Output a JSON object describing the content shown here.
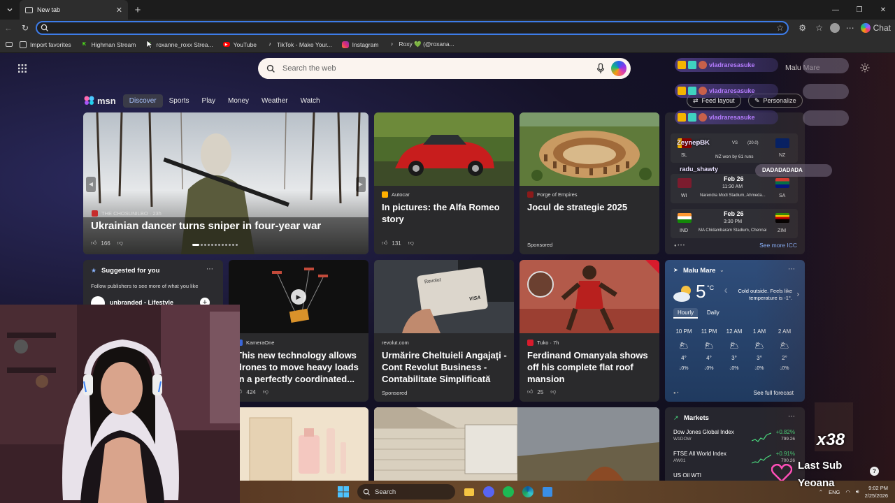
{
  "browser": {
    "tab_title": "New tab",
    "address_value": "",
    "chat_label": "Chat",
    "bookmarks": [
      {
        "label": "Import favorites"
      },
      {
        "label": "Highman Stream"
      },
      {
        "label": "roxanne_roxx Strea..."
      },
      {
        "label": "YouTube"
      },
      {
        "label": "TikTok - Make Your..."
      },
      {
        "label": "Instagram"
      },
      {
        "label": "Roxy 💚 (@roxana..."
      }
    ]
  },
  "newtab": {
    "search_placeholder": "Search the web",
    "user_name": "Malu Mare",
    "feed_layout_label": "Feed layout",
    "personalize_label": "Personalize"
  },
  "msn": {
    "logo": "msn",
    "nav": [
      {
        "label": "Discover",
        "active": true
      },
      {
        "label": "Sports"
      },
      {
        "label": "Play"
      },
      {
        "label": "Money"
      },
      {
        "label": "Weather"
      },
      {
        "label": "Watch"
      }
    ]
  },
  "cards": {
    "hero": {
      "source": "THE CHOSUNILBO · 23h",
      "title": "Ukrainian dancer turns sniper in four-year war",
      "likes": "166"
    },
    "alfa": {
      "source": "Autocar",
      "title": "In pictures: the Alfa Romeo story",
      "likes": "131"
    },
    "forge": {
      "source": "Forge of Empires",
      "title": "Jocul de strategie 2025",
      "sponsored": "Sponsored"
    },
    "suggested": {
      "header": "Suggested for you",
      "sub": "Follow publishers to see more of what you like",
      "publisher": "unbranded - Lifestyle"
    },
    "drone": {
      "source": "KameraOne",
      "title_lines": [
        "This new technology allows",
        "drones to move heavy loads",
        "in a perfectly coordinated..."
      ],
      "likes": "424"
    },
    "revolut": {
      "source": "revolut.com",
      "title": "Urmărire Cheltuieli Angajați - Cont Revolut Business - Contabilitate Simplificată",
      "sponsored": "Sponsored",
      "card_brand": "Revolut",
      "card_network": "VISA"
    },
    "omanyala": {
      "source": "Tuko · 7h",
      "title": "Ferdinand Omanyala shows off his complete flat roof mansion",
      "likes": "25"
    }
  },
  "cricket": {
    "match1": {
      "team1": "SL",
      "team1_score": "(20.0)",
      "vs": "VS",
      "team2": "NZ",
      "team2_score": "(20.0)",
      "result": "NZ won by 61 runs"
    },
    "match2": {
      "date": "Feb 26",
      "time": "11:30 AM",
      "team1": "WI",
      "team2": "SA",
      "venue": "Narendra Modi Stadium, Ahmeda..."
    },
    "match3": {
      "date": "Feb 26",
      "time": "3:30 PM",
      "team1": "IND",
      "team2": "ZIM",
      "venue": "MA Chidambaram Stadium, Chennai"
    },
    "see_more": "See more ICC"
  },
  "weather": {
    "location": "Malu Mare",
    "temp": "5",
    "unit": "°C",
    "desc": "Cold outside. Feels like temperature is -1°.",
    "tab_hourly": "Hourly",
    "tab_daily": "Daily",
    "hours": [
      {
        "time": "10 PM",
        "temp": "4°",
        "precip": "0%"
      },
      {
        "time": "11 PM",
        "temp": "4°",
        "precip": "0%"
      },
      {
        "time": "12 AM",
        "temp": "3°",
        "precip": "0%"
      },
      {
        "time": "1 AM",
        "temp": "3°",
        "precip": "0%"
      },
      {
        "time": "2 AM",
        "temp": "2°",
        "precip": "0%"
      }
    ],
    "full_forecast": "See full forecast"
  },
  "markets": {
    "title": "Markets",
    "rows": [
      {
        "name": "Dow Jones Global Index",
        "code": "W1DOW",
        "change": "+0.82%",
        "value": "799.26"
      },
      {
        "name": "FTSE All World Index",
        "code": "AW01",
        "change": "+0.91%",
        "value": "700.26"
      },
      {
        "name": "US Oil WTI",
        "code": "",
        "change": "",
        "value": ""
      }
    ]
  },
  "taskbar": {
    "search_label": "Search",
    "lang": "ENG",
    "time": "9:02 PM",
    "date": "2/25/2026"
  },
  "overlay": {
    "chat_user": "vladraresasuke",
    "names": [
      "ZeynepBK",
      "radu_shawty",
      "DADADADADA"
    ],
    "count": "x38",
    "last_sub_label": "Last Sub",
    "last_sub_name": "Yeoana"
  },
  "colors": {
    "accent": "#3d7ce8",
    "chat_name": "#b57cff",
    "market_up": "#4ade80"
  }
}
